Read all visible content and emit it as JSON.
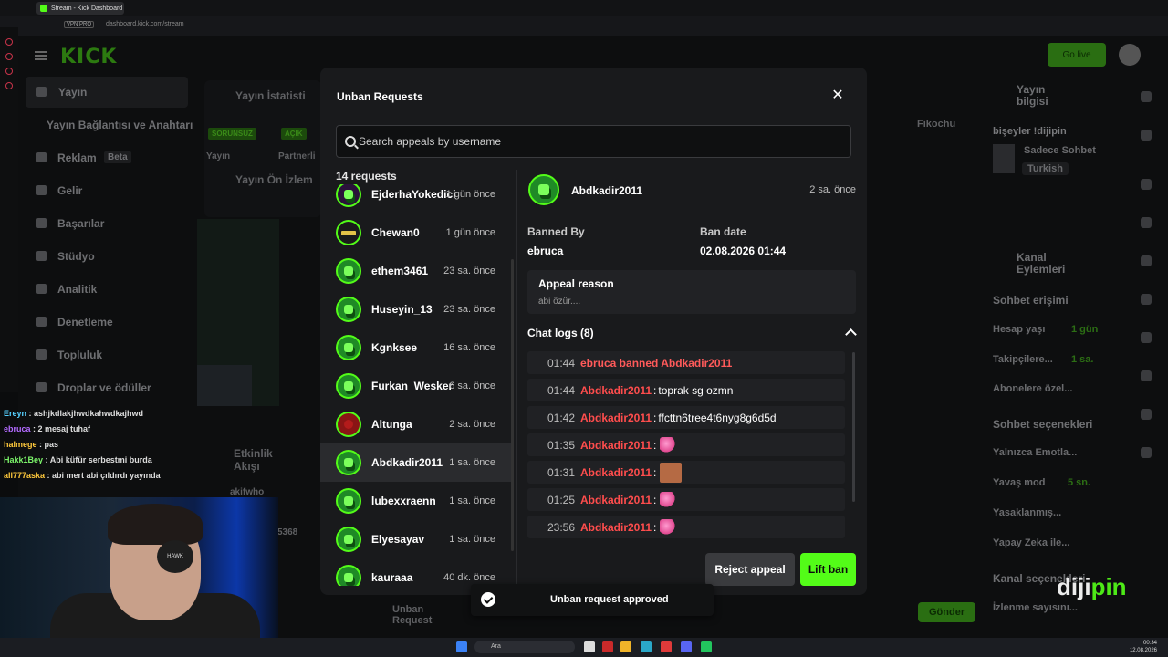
{
  "browser": {
    "tab_title": "Stream - Kick Dashboard",
    "url": "dashboard.kick.com/stream",
    "vpn": "VPN PRO"
  },
  "dashboard": {
    "logo": "KICK",
    "go_live": "Go live",
    "nav": [
      {
        "label": "Yayın"
      },
      {
        "label": "Yayın Bağlantısı ve Anahtarı"
      },
      {
        "label": "Reklam",
        "badge": "Beta"
      },
      {
        "label": "Gelir"
      },
      {
        "label": "Başarılar"
      },
      {
        "label": "Stüdyo"
      },
      {
        "label": "Analitik"
      },
      {
        "label": "Denetleme"
      },
      {
        "label": "Topluluk"
      },
      {
        "label": "Droplar ve ödüller"
      }
    ],
    "panels": {
      "stats": "Yayın İstatisti",
      "preview": "Yayın Ön İzlem",
      "activity": "Etkinlik Akışı",
      "unban_requests": "Unban Request",
      "tag1": "SORUNSUZ",
      "tag2": "AÇIK",
      "sub1": "Yayın",
      "sub2": "Partnerli",
      "fikochu": "Fikochu",
      "activity_user": "akifwho",
      "activity_5368": "5368",
      "send": "Gönder"
    },
    "right": {
      "info_title": "Yayın bilgisi",
      "stream_title": "bişeyler !dijipin",
      "category": "Sadece Sohbet",
      "language": "Turkish",
      "actions_title": "Kanal Eylemleri",
      "chat_access": "Sohbet erişimi",
      "account_age": "Hesap yaşı",
      "account_age_val": "1 gün",
      "followers": "Takipçilere...",
      "followers_val": "1 sa.",
      "subs_only": "Abonelere özel...",
      "chat_options": "Sohbet seçenekleri",
      "emote_only": "Yalnızca Emotla...",
      "slow_mode": "Yavaş mod",
      "slow_mode_val": "5 sn.",
      "banned": "Yasaklanmış...",
      "ai": "Yapay Zeka ile...",
      "channel_opts": "Kanal seçenekleri",
      "viewers": "İzlenme sayısını..."
    }
  },
  "stream_chat": [
    {
      "user": "Ereyn",
      "msg": "ashjkdlakjhwdkahwdkajhwd",
      "color": "#56d0ff"
    },
    {
      "user": "ebruca",
      "msg": "2 mesaj tuhaf",
      "color": "#b36bff"
    },
    {
      "user": "halmege",
      "msg": "pas",
      "color": "#ffc93c"
    },
    {
      "user": "Hakk1Bey",
      "msg": "Abi küfür serbestmi burda",
      "color": "#7cf46a"
    },
    {
      "user": "all777aska",
      "msg": "abi mert abi çıldırdı yayında",
      "color": "#ffc93c"
    }
  ],
  "webcam": {
    "headset_brand": "HAWK"
  },
  "modal": {
    "title": "Unban Requests",
    "search_placeholder": "Search appeals by username",
    "count_label": "14 requests",
    "requests": [
      {
        "name": "EjderhaYokedici",
        "time": "1 gün önce",
        "avatar": "purple"
      },
      {
        "name": "Chewan0",
        "time": "1 gün önce",
        "avatar": "dark"
      },
      {
        "name": "ethem3461",
        "time": "23 sa. önce",
        "avatar": "green"
      },
      {
        "name": "Huseyin_13",
        "time": "23 sa. önce",
        "avatar": "green"
      },
      {
        "name": "Kgnksee",
        "time": "16 sa. önce",
        "avatar": "green"
      },
      {
        "name": "Furkan_Wesker",
        "time": "6 sa. önce",
        "avatar": "green"
      },
      {
        "name": "Altunga",
        "time": "2 sa. önce",
        "avatar": "red"
      },
      {
        "name": "Abdkadir2011",
        "time": "1 sa. önce",
        "avatar": "green",
        "selected": true
      },
      {
        "name": "lubexxraenn",
        "time": "1 sa. önce",
        "avatar": "green"
      },
      {
        "name": "Elyesayav",
        "time": "1 sa. önce",
        "avatar": "green"
      },
      {
        "name": "kauraaa",
        "time": "40 dk. önce",
        "avatar": "green"
      }
    ],
    "detail": {
      "username": "Abdkadir2011",
      "time": "2 sa. önce",
      "banned_by_label": "Banned By",
      "banned_by": "ebruca",
      "ban_date_label": "Ban date",
      "ban_date": "02.08.2026 01:44",
      "appeal_reason_label": "Appeal reason",
      "appeal_reason": "abi özür....",
      "chat_logs_label": "Chat logs (8)",
      "logs": [
        {
          "time": "01:44",
          "system": "ebruca banned Abdkadir2011"
        },
        {
          "time": "01:44",
          "user": "Abdkadir2011",
          "msg": "toprak sg ozmn"
        },
        {
          "time": "01:42",
          "user": "Abdkadir2011",
          "msg": "ffcttn6tree4t6nyg8g6d5d"
        },
        {
          "time": "01:35",
          "user": "Abdkadir2011",
          "emote": "pink"
        },
        {
          "time": "01:31",
          "user": "Abdkadir2011",
          "emote": "face"
        },
        {
          "time": "01:25",
          "user": "Abdkadir2011",
          "emote": "pink"
        },
        {
          "time": "23:56",
          "user": "Abdkadir2011",
          "emote": "pink"
        }
      ]
    },
    "reject_label": "Reject appeal",
    "lift_label": "Lift ban"
  },
  "toast": {
    "message": "Unban request approved"
  },
  "taskbar": {
    "search": "Ara",
    "time": "00:34",
    "date": "12.08.2026"
  },
  "watermark": {
    "prefix": "diji",
    "suffix": "pin"
  }
}
